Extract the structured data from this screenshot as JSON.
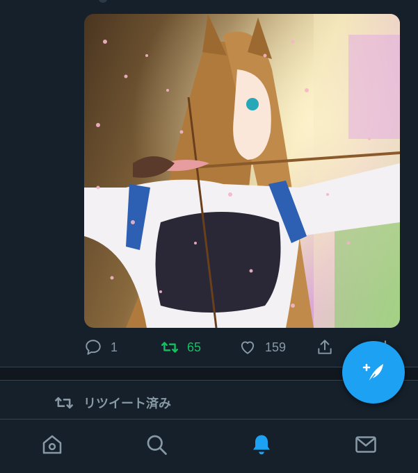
{
  "tweet": {
    "media": {
      "alt": ""
    },
    "actions": {
      "reply_count": "1",
      "retweet_count": "65",
      "like_count": "159"
    }
  },
  "retweet_notice": {
    "label": "リツイート済み"
  },
  "colors": {
    "background": "#15202b",
    "muted_text": "#8899a6",
    "retweet_active": "#17bf63",
    "accent": "#1da1f2",
    "divider": "#38444d"
  },
  "icons": {
    "reply": "reply-icon",
    "retweet": "retweet-icon",
    "like": "heart-icon",
    "share": "share-icon",
    "compose": "compose-tweet-icon",
    "home": "home-icon",
    "search": "search-icon",
    "notifications": "bell-icon",
    "messages": "mail-icon"
  },
  "tabbar": {
    "active_tab": "notifications"
  }
}
